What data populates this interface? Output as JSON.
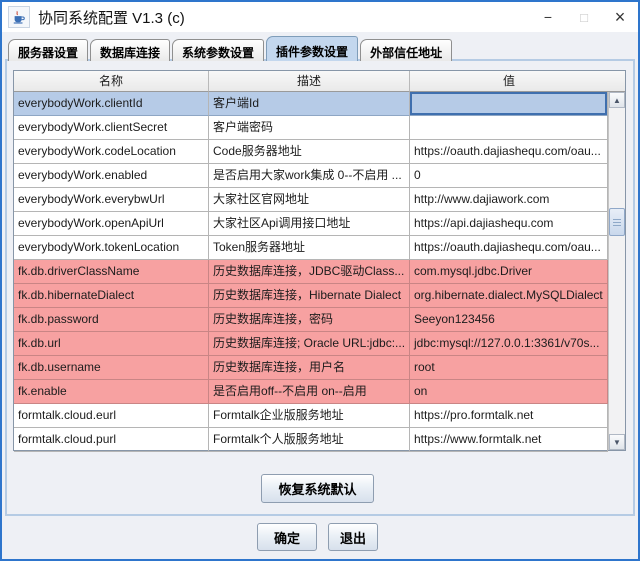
{
  "window": {
    "title": "协同系统配置 V1.3 (c)",
    "controls": {
      "minimize": "−",
      "maximize": "□",
      "close": "×"
    }
  },
  "tabs": [
    {
      "label": "服务器设置",
      "selected": false
    },
    {
      "label": "数据库连接",
      "selected": false
    },
    {
      "label": "系统参数设置",
      "selected": false
    },
    {
      "label": "插件参数设置",
      "selected": true
    },
    {
      "label": "外部信任地址",
      "selected": false
    }
  ],
  "table": {
    "columns": [
      "名称",
      "描述",
      "值"
    ],
    "rows": [
      {
        "name": "everybodyWork.clientId",
        "desc": "客户端Id",
        "value": "",
        "state": "selected"
      },
      {
        "name": "everybodyWork.clientSecret",
        "desc": "客户端密码",
        "value": "",
        "state": "normal"
      },
      {
        "name": "everybodyWork.codeLocation",
        "desc": "Code服务器地址",
        "value": "https://oauth.dajiashequ.com/oau...",
        "state": "normal"
      },
      {
        "name": "everybodyWork.enabled",
        "desc": "是否启用大家work集成 0--不启用  ...",
        "value": "0",
        "state": "normal"
      },
      {
        "name": "everybodyWork.everybwUrl",
        "desc": "大家社区官网地址",
        "value": "http://www.dajiawork.com",
        "state": "normal"
      },
      {
        "name": "everybodyWork.openApiUrl",
        "desc": "大家社区Api调用接口地址",
        "value": "https://api.dajiashequ.com",
        "state": "normal"
      },
      {
        "name": "everybodyWork.tokenLocation",
        "desc": "Token服务器地址",
        "value": "https://oauth.dajiashequ.com/oau...",
        "state": "normal"
      },
      {
        "name": "fk.db.driverClassName",
        "desc": "历史数据库连接，JDBC驱动Class...",
        "value": "com.mysql.jdbc.Driver",
        "state": "pink"
      },
      {
        "name": "fk.db.hibernateDialect",
        "desc": "历史数据库连接，Hibernate Dialect",
        "value": "org.hibernate.dialect.MySQLDialect",
        "state": "pink"
      },
      {
        "name": "fk.db.password",
        "desc": "历史数据库连接，密码",
        "value": "Seeyon123456",
        "state": "pink"
      },
      {
        "name": "fk.db.url",
        "desc": "历史数据库连接; Oracle URL:jdbc:...",
        "value": "jdbc:mysql://127.0.0.1:3361/v70s...",
        "state": "pink"
      },
      {
        "name": "fk.db.username",
        "desc": "历史数据库连接，用户名",
        "value": "root",
        "state": "pink"
      },
      {
        "name": "fk.enable",
        "desc": "是否启用off--不启用  on--启用",
        "value": "on",
        "state": "pink"
      },
      {
        "name": "formtalk.cloud.eurl",
        "desc": "Formtalk企业版服务地址",
        "value": "https://pro.formtalk.net",
        "state": "normal"
      },
      {
        "name": "formtalk.cloud.purl",
        "desc": "Formtalk个人版服务地址",
        "value": "https://www.formtalk.net",
        "state": "normal"
      }
    ]
  },
  "scrollbar": {
    "up": "▲",
    "down": "▼"
  },
  "buttons": {
    "restore": "恢复系统默认",
    "ok": "确定",
    "exit": "退出"
  },
  "colors": {
    "window_border": "#2e75cc",
    "selected_row": "#b6cbe7",
    "focus_cell_border": "#3f6fae",
    "pink_row": "#f7a1a1",
    "selected_tab": "#c3d7ee"
  }
}
